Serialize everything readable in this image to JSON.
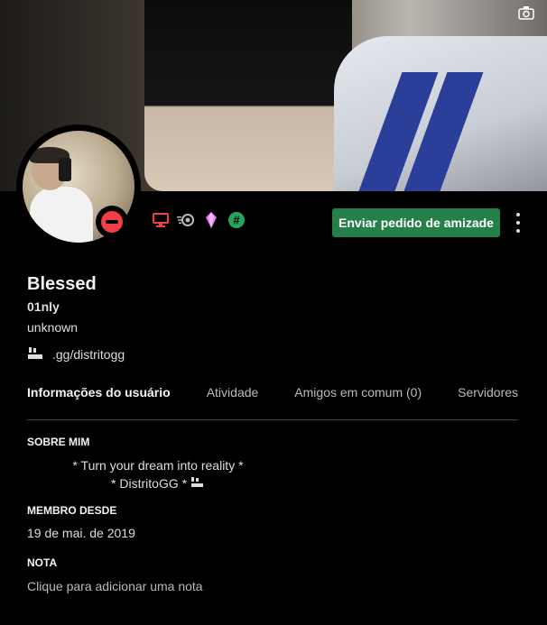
{
  "banner": {
    "camera_icon": "camera-icon"
  },
  "profile": {
    "status": "dnd",
    "display_name": "Blessed",
    "username": "01nly",
    "pronouns": "unknown",
    "custom_status": ".gg/distritogg"
  },
  "badges": [
    {
      "icon": "monitor-icon",
      "color": "#f23f43"
    },
    {
      "icon": "nitro-icon",
      "color": "#b5bac1"
    },
    {
      "icon": "gem-icon",
      "color": "#e879f9"
    },
    {
      "icon": "hashtag-icon",
      "color": "#23a55a"
    }
  ],
  "actions": {
    "friend_request_label": "Enviar pedido de amizade"
  },
  "tabs": [
    {
      "label": "Informações do usuário",
      "active": true
    },
    {
      "label": "Atividade",
      "active": false
    },
    {
      "label": "Amigos em comum (0)",
      "active": false
    },
    {
      "label": "Servidores em co",
      "active": false
    }
  ],
  "about": {
    "heading": "SOBRE MIM",
    "line1": "* Turn your dream into reality *",
    "line2": "* DistritoGG *"
  },
  "member_since": {
    "heading": "MEMBRO DESDE",
    "date": "19 de mai. de 2019"
  },
  "note": {
    "heading": "NOTA",
    "placeholder": "Clique para adicionar uma nota"
  },
  "colors": {
    "accent_green": "#248046",
    "background": "#000000",
    "dnd_red": "#f23f43"
  }
}
